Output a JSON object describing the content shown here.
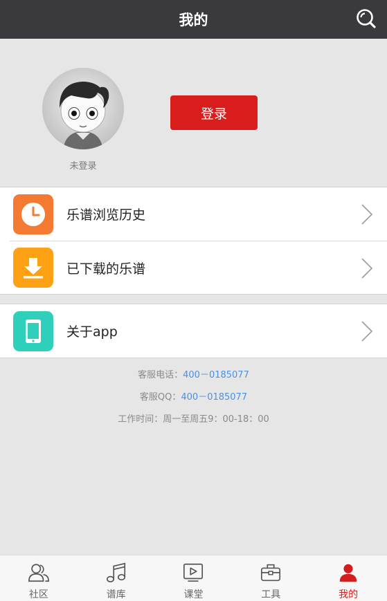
{
  "header": {
    "title": "我的",
    "search_icon": "search-icon"
  },
  "profile": {
    "avatar_label": "未登录",
    "login_label": "登录",
    "login_color": "#d91c1c"
  },
  "menu_group_1": [
    {
      "label": "乐谱浏览历史",
      "icon": "clock-icon",
      "color": "#f47a32"
    },
    {
      "label": "已下载的乐谱",
      "icon": "download-icon",
      "color": "#ffa114"
    }
  ],
  "menu_group_2": [
    {
      "label": "关于app",
      "icon": "phone-icon",
      "color": "#2fcfbb"
    }
  ],
  "contact": {
    "phone_label": "客服电话：",
    "phone_value": "400－0185077",
    "qq_label": "客服QQ：",
    "qq_value": "400－0185077",
    "hours": "工作时间：周一至周五9：00-18：00",
    "link_color": "#4a90e2"
  },
  "tabbar": {
    "items": [
      {
        "label": "社区",
        "icon": "community-icon"
      },
      {
        "label": "谱库",
        "icon": "music-note-icon"
      },
      {
        "label": "课堂",
        "icon": "video-play-icon"
      },
      {
        "label": "工具",
        "icon": "toolbox-icon"
      },
      {
        "label": "我的",
        "icon": "person-icon"
      }
    ],
    "active": "我的",
    "active_color": "#d21e1e"
  }
}
